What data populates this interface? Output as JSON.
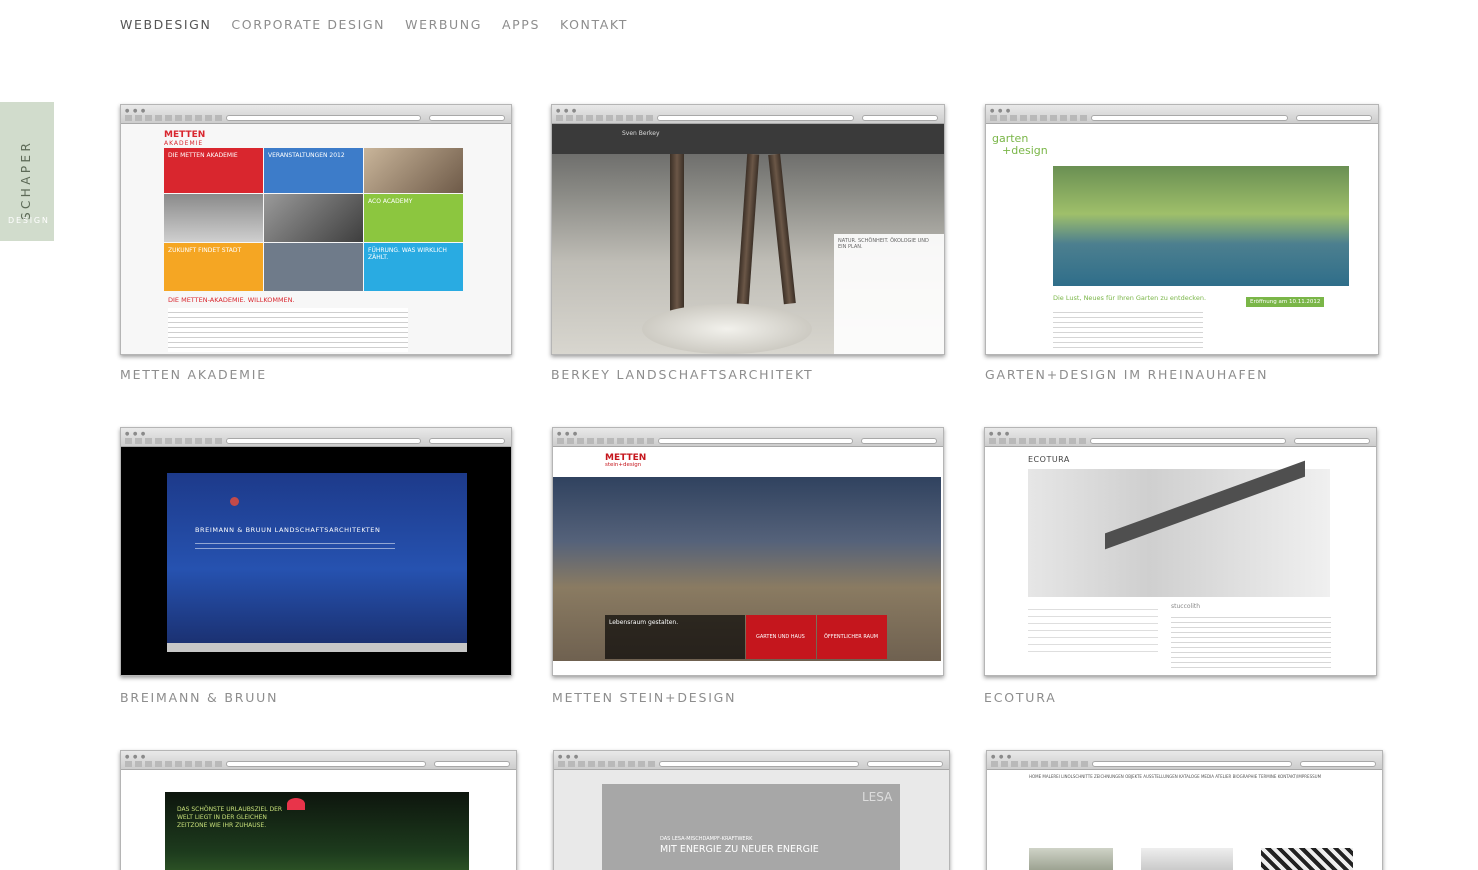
{
  "nav": {
    "items": [
      {
        "label": "WEBDESIGN",
        "active": true
      },
      {
        "label": "CORPORATE DESIGN",
        "active": false
      },
      {
        "label": "WERBUNG",
        "active": false
      },
      {
        "label": "APPS",
        "active": false
      },
      {
        "label": "KONTAKT",
        "active": false
      }
    ]
  },
  "logo": {
    "line1": "SCHAPER",
    "line2": "DESIGN"
  },
  "projects": [
    {
      "caption": "METTEN AKADEMIE"
    },
    {
      "caption": "BERKEY LANDSCHAFTSARCHITEKT"
    },
    {
      "caption": "GARTEN+DESIGN IM RHEINAUHAFEN"
    },
    {
      "caption": "BREIMANN & BRUUN"
    },
    {
      "caption": "METTEN STEIN+DESIGN"
    },
    {
      "caption": "ECOTURA"
    }
  ],
  "thumbs": {
    "metten": {
      "brand": "METTEN",
      "sub": "AKADEMIE",
      "box1": "DIE METTEN AKADEMIE",
      "box2": "VERANSTALTUNGEN 2012",
      "box3": "ACO ACADEMY",
      "box4": "ZUKUNFT FINDET STADT",
      "box5": "FÜHRUNG. WAS WIRKLICH ZÄHLT.",
      "welcome": "DIE METTEN-AKADEMIE. WILLKOMMEN."
    },
    "berkey": {
      "logo": "Sven Berkey",
      "tag": "NATUR. SCHÖNHEIT. ÖKOLOGIE UND EIN PLAN."
    },
    "garten": {
      "logo1": "garten",
      "logo2": "+design",
      "headline": "Die Lust, Neues für Ihren Garten zu entdecken.",
      "badge": "Eröffnung am 10.11.2012"
    },
    "breimann": {
      "title": "BREIMANN & BRUUN LANDSCHAFTSARCHITEKTEN"
    },
    "steindesign": {
      "brand": "METTEN",
      "sub": "stein+design",
      "btn1": "GARTEN UND HAUS",
      "btn2": "ÖFFENTLICHER RAUM",
      "tag": "Lebensraum gestalten."
    },
    "ecotura": {
      "brand": "ECOTURA",
      "product": "stuccolith"
    },
    "spring": {
      "text": "DAS SCHÖNSTE URLAUBSZIEL DER WELT LIEGT IN DER GLEICHEN ZEITZONE WIE IHR ZUHAUSE."
    },
    "lesa": {
      "brand": "LESA",
      "line1": "DAS LESA-MISCHDAMPF-KRAFTWERK",
      "line2": "MIT ENERGIE ZU NEUER ENERGIE"
    },
    "hinz": {
      "menu": "HOME  MALEREI  LINOLSCHNITTE  ZEICHNUNGEN  OBJEKTE  AUSSTELLUNGEN  KATALOGE  MEDIA  ATELIER  BIOGRAPHIE  TERMINE  KONTAKT/IMPRESSUM"
    }
  },
  "colors": {
    "logo_bg": "#d1dccc",
    "metten_red": "#d9262e",
    "metten_blue": "#3d7cc9",
    "metten_green": "#8cc63f",
    "metten_orange": "#f5a623",
    "metten_cyan": "#29abe2",
    "breimann_blue": "#1f3f8f"
  }
}
